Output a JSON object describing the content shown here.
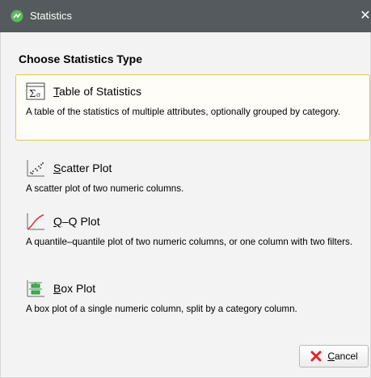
{
  "window": {
    "title": "Statistics",
    "close_glyph": "✕"
  },
  "heading": "Choose Statistics Type",
  "options": [
    {
      "mnemonic": "T",
      "label_rest": "able of Statistics",
      "description": "A table of the statistics of multiple attributes, optionally grouped by category.",
      "icon": "table-of-statistics-icon",
      "selected": true
    },
    {
      "mnemonic": "S",
      "label_rest": "catter Plot",
      "description": "A scatter plot of two numeric columns.",
      "icon": "scatter-plot-icon",
      "selected": false
    },
    {
      "mnemonic": "Q",
      "label_rest": "–Q Plot",
      "description": "A quantile–quantile plot of two numeric columns, or one column with two filters.",
      "icon": "qq-plot-icon",
      "selected": false
    },
    {
      "mnemonic": "B",
      "label_rest": "ox Plot",
      "description": "A box plot of a single numeric column, split by a category column.",
      "icon": "box-plot-icon",
      "selected": false
    }
  ],
  "cancel_button": {
    "mnemonic": "C",
    "label_rest": "ancel",
    "icon": "cancel-x-icon"
  },
  "colors": {
    "titlebar": "#545a5d",
    "selected_border": "#f2bf4e",
    "app_icon": "#5cb85c",
    "cancel_icon": "#e2262d"
  }
}
